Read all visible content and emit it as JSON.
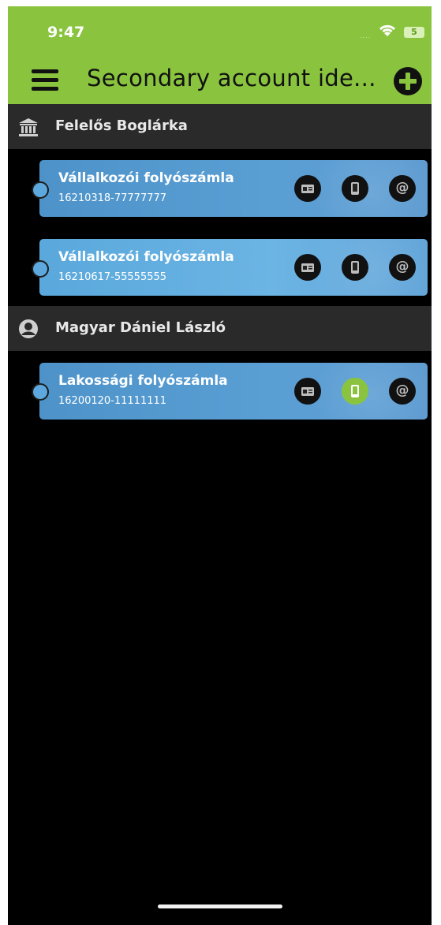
{
  "status_bar": {
    "time": "9:47",
    "battery": "5",
    "signal": "...."
  },
  "header": {
    "title": "Secondary account ide...",
    "accent_color": "#8ac43f"
  },
  "groups": [
    {
      "name": "Felelős Boglárka",
      "icon": "bank-icon",
      "accounts": [
        {
          "name": "Vállalkozói folyószámla",
          "number": "16210318-77777777",
          "active_action": ""
        },
        {
          "name": "Vállalkozói folyószámla",
          "number": "16210617-55555555",
          "active_action": ""
        }
      ]
    },
    {
      "name": "Magyar Dániel László",
      "icon": "user-icon",
      "accounts": [
        {
          "name": "Lakossági folyószámla",
          "number": "16200120-11111111",
          "active_action": "phone"
        }
      ]
    }
  ],
  "actions": {
    "id_card": "id-card-icon",
    "phone": "phone-icon",
    "email": "@"
  },
  "colors": {
    "card_blue": "#5a9fd4",
    "background": "#000000",
    "group_bar": "#2a2a2a"
  }
}
